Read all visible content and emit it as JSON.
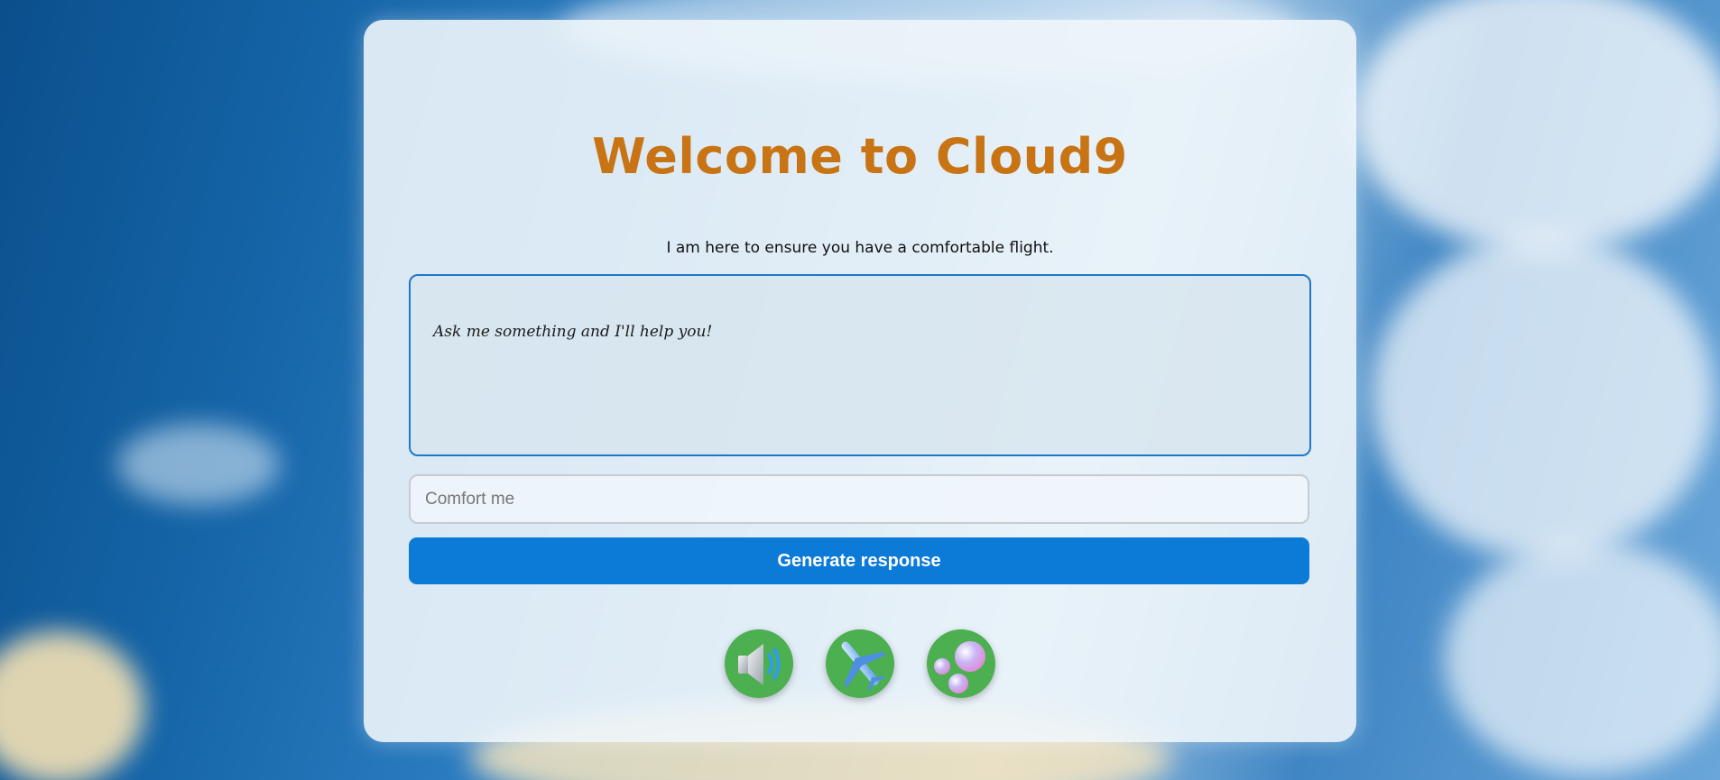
{
  "header": {
    "title": "Welcome to Cloud9",
    "subtitle": "I am here to ensure you have a comfortable flight."
  },
  "response": {
    "text": "Ask me something and I'll help you!"
  },
  "form": {
    "input_placeholder": "Comfort me",
    "input_value": "",
    "submit_label": "Generate response"
  },
  "actions": [
    {
      "icon": "speaker-icon"
    },
    {
      "icon": "airplane-icon"
    },
    {
      "icon": "bubbles-icon"
    }
  ],
  "colors": {
    "title": "#c87414",
    "button": "#0c7bd8",
    "border_accent": "#1f77c9",
    "icon_bg": "#4caf50"
  }
}
